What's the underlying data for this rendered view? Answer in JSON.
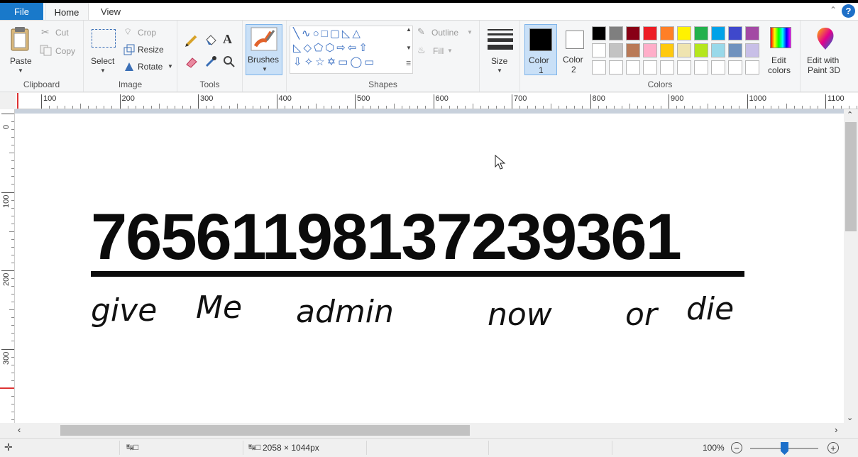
{
  "tabs": {
    "file": "File",
    "home": "Home",
    "view": "View"
  },
  "clipboard": {
    "paste": "Paste",
    "cut": "Cut",
    "copy": "Copy",
    "label": "Clipboard"
  },
  "image": {
    "select": "Select",
    "crop": "Crop",
    "resize": "Resize",
    "rotate": "Rotate",
    "label": "Image"
  },
  "tools": {
    "label": "Tools"
  },
  "brushes": {
    "label": "Brushes"
  },
  "shapes": {
    "outline": "Outline",
    "fill": "Fill",
    "label": "Shapes"
  },
  "size": {
    "label": "Size"
  },
  "colors": {
    "color1": "Color",
    "color1_num": "1",
    "color2": "Color",
    "color2_num": "2",
    "edit_colors_1": "Edit",
    "edit_colors_2": "colors",
    "edit_paint3d_1": "Edit with",
    "edit_paint3d_2": "Paint 3D",
    "label": "Colors",
    "color1_value": "#000000",
    "color2_value": "#ffffff",
    "palette_row1": [
      "#000000",
      "#7f7f7f",
      "#880015",
      "#ed1c24",
      "#ff7f27",
      "#fff200",
      "#22b14c",
      "#00a2e8",
      "#3f48cc",
      "#a349a4"
    ],
    "palette_row2": [
      "#ffffff",
      "#c3c3c3",
      "#b97a57",
      "#ffaec9",
      "#ffc90e",
      "#efe4b0",
      "#b5e61d",
      "#99d9ea",
      "#7092be",
      "#c8bfe7"
    ],
    "palette_row3": [
      "#ffffff",
      "#ffffff",
      "#ffffff",
      "#ffffff",
      "#ffffff",
      "#ffffff",
      "#ffffff",
      "#ffffff",
      "#ffffff",
      "#ffffff"
    ]
  },
  "ruler": {
    "top": [
      "100",
      "200",
      "300",
      "400",
      "500",
      "600",
      "700",
      "800",
      "900",
      "1000",
      "1100"
    ],
    "left": [
      "0",
      "100",
      "200",
      "300"
    ]
  },
  "canvas": {
    "number": "76561198137239361",
    "hand_words": [
      "give",
      "Me",
      "admin",
      "now",
      "or",
      "die"
    ]
  },
  "status": {
    "dimensions": "2058 × 1044px",
    "zoom": "100%"
  }
}
